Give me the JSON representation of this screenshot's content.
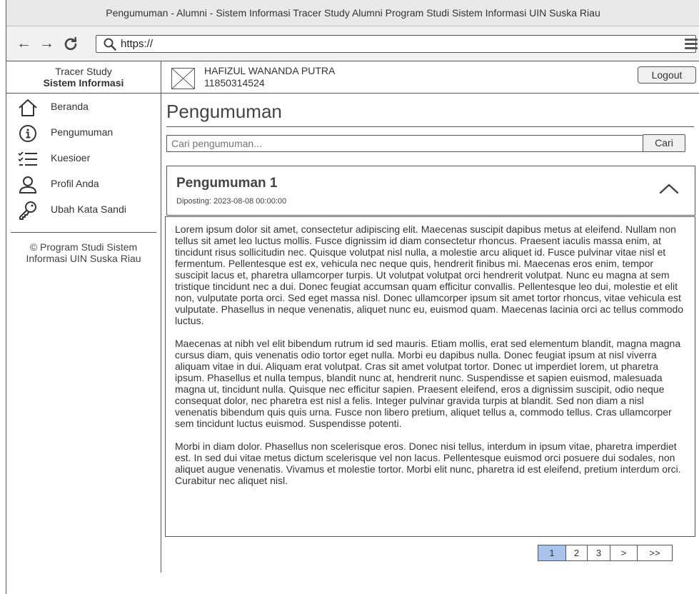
{
  "window": {
    "title": "Pengumuman - Alumni - Sistem Informasi Tracer Study Alumni Program Studi Sistem Informasi UIN Suska Riau",
    "url": "https://"
  },
  "sidebar": {
    "brand_line1": "Tracer Study",
    "brand_line2": "Sistem Informasi",
    "items": [
      {
        "label": "Beranda",
        "icon": "home-icon"
      },
      {
        "label": "Pengumuman",
        "icon": "info-icon"
      },
      {
        "label": "Kuesioer",
        "icon": "checklist-icon"
      },
      {
        "label": "Profil Anda",
        "icon": "user-icon"
      },
      {
        "label": "Ubah Kata Sandi",
        "icon": "key-icon"
      }
    ],
    "copyright": "© Program Studi Sistem Informasi UIN Suska Riau"
  },
  "header": {
    "user_name": "HAFIZUL WANANDA PUTRA",
    "user_id": "11850314524",
    "logout_label": "Logout"
  },
  "main": {
    "page_title": "Pengumuman",
    "search_placeholder": "Cari pengumuman...",
    "search_button": "Cari",
    "announcement": {
      "title": "Pengumuman 1",
      "posted": "Diposting: 2023-08-08 00:00:00",
      "paragraphs": [
        "Lorem ipsum dolor sit amet, consectetur adipiscing elit. Maecenas suscipit dapibus metus at eleifend. Nullam non tellus sit amet leo luctus mollis. Fusce dignissim id diam consectetur rhoncus. Praesent iaculis massa enim, at tincidunt risus sollicitudin nec. Quisque volutpat nisl nulla, a molestie arcu aliquet id. Fusce pulvinar vitae nisl et fermentum. Pellentesque est ex, vehicula nec neque quis, hendrerit finibus mi. Maecenas eros enim, tempor suscipit lacus et, pharetra ullamcorper turpis. Ut volutpat volutpat orci hendrerit volutpat. Nunc eu magna at sem tristique tincidunt nec a dui. Donec feugiat accumsan quam efficitur convallis. Pellentesque leo dui, molestie et elit non, vulputate porta orci. Sed eget massa nisl. Donec ullamcorper ipsum sit amet tortor rhoncus, vitae vehicula est vulputate. Phasellus in neque venenatis, aliquet nunc eu, euismod quam. Maecenas lacinia orci ac tellus commodo luctus.",
        "Maecenas at nibh vel elit bibendum rutrum id sed mauris. Etiam mollis, erat sed elementum blandit, magna magna cursus diam, quis venenatis odio tortor eget nulla. Morbi eu dapibus nulla. Donec feugiat ipsum at nisl viverra aliquam vitae in dui. Aliquam erat volutpat. Cras sit amet volutpat tortor. Donec ut imperdiet lorem, ut pharetra ipsum. Phasellus et nulla tempus, blandit nunc at, hendrerit nunc. Suspendisse et sapien euismod, malesuada magna ut, tincidunt nulla. Quisque nec efficitur sapien. Praesent eleifend, eros a dignissim suscipit, odio neque consequat dolor, nec pharetra est nisl a felis. Integer pulvinar gravida turpis at blandit. Sed non diam a nisl venenatis bibendum quis quis urna. Fusce non libero pretium, aliquet tellus a, commodo tellus. Cras ullamcorper sem tincidunt luctus euismod. Suspendisse potenti.",
        "Morbi in diam dolor. Phasellus non scelerisque eros. Donec nisi tellus, interdum in ipsum vitae, pharetra imperdiet est. In sed dui vitae metus dictum scelerisque vel non lacus. Pellentesque euismod orci posuere dui sodales, non aliquet augue venenatis. Vivamus et molestie tortor. Morbi elit nunc, pharetra id est eleifend, pretium interdum orci. Curabitur nec aliquet nisl."
      ]
    },
    "pagination": {
      "pages": [
        "1",
        "2",
        "3",
        ">",
        ">>"
      ],
      "active": "1"
    }
  },
  "colors": {
    "active_page": "#a9c4ea",
    "border": "#555555",
    "titlebar": "#e9e9e9"
  }
}
